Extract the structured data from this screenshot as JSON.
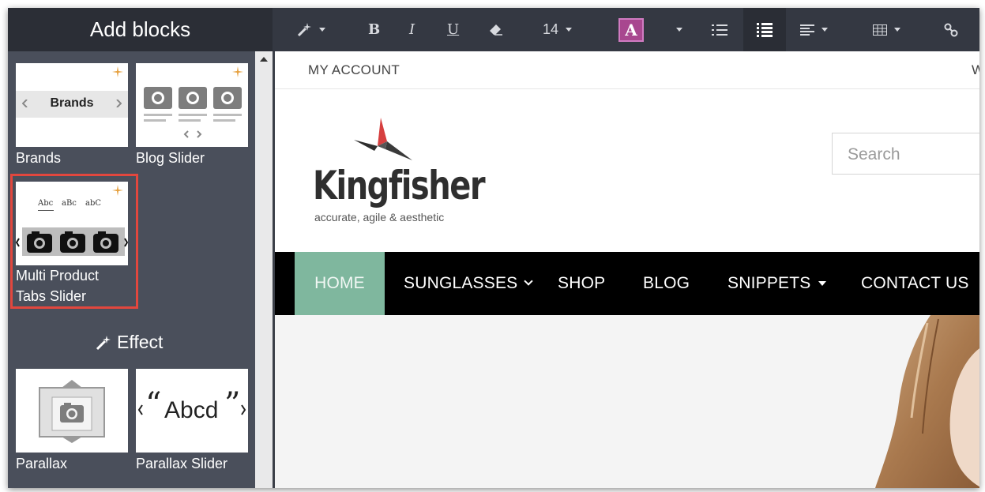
{
  "sidebar": {
    "title": "Add blocks",
    "blocks": [
      {
        "label": "Brands",
        "thumb_text": "Brands"
      },
      {
        "label": "Blog Slider"
      },
      {
        "label_line1": "Multi Product",
        "label_line2": "Tabs Slider",
        "tabs": [
          "Abc",
          "aBc",
          "abC"
        ],
        "selected": true
      }
    ],
    "effect_title": "Effect",
    "effect_blocks": [
      {
        "label": "Parallax"
      },
      {
        "label": "Parallax Slider",
        "thumb_text": "Abcd"
      }
    ]
  },
  "toolbar": {
    "font_size": "14",
    "bold": "B",
    "italic": "I",
    "underline": "U",
    "font_color_letter": "A"
  },
  "site": {
    "top_link": "MY ACCOUNT",
    "top_right_partial": "W",
    "logo_name": "Kingfisher",
    "logo_tagline": "accurate, agile & aesthetic",
    "search_placeholder": "Search",
    "nav": [
      "HOME",
      "SUNGLASSES",
      "SHOP",
      "BLOG",
      "SNIPPETS",
      "CONTACT US"
    ],
    "active_nav": "HOME"
  },
  "colors": {
    "toolbar": "#343842",
    "sidebar": "#4a4f5b",
    "selected_outline": "#e2473e",
    "nav_active": "#7fb79e",
    "font_color_swatch": "#a8478f"
  }
}
